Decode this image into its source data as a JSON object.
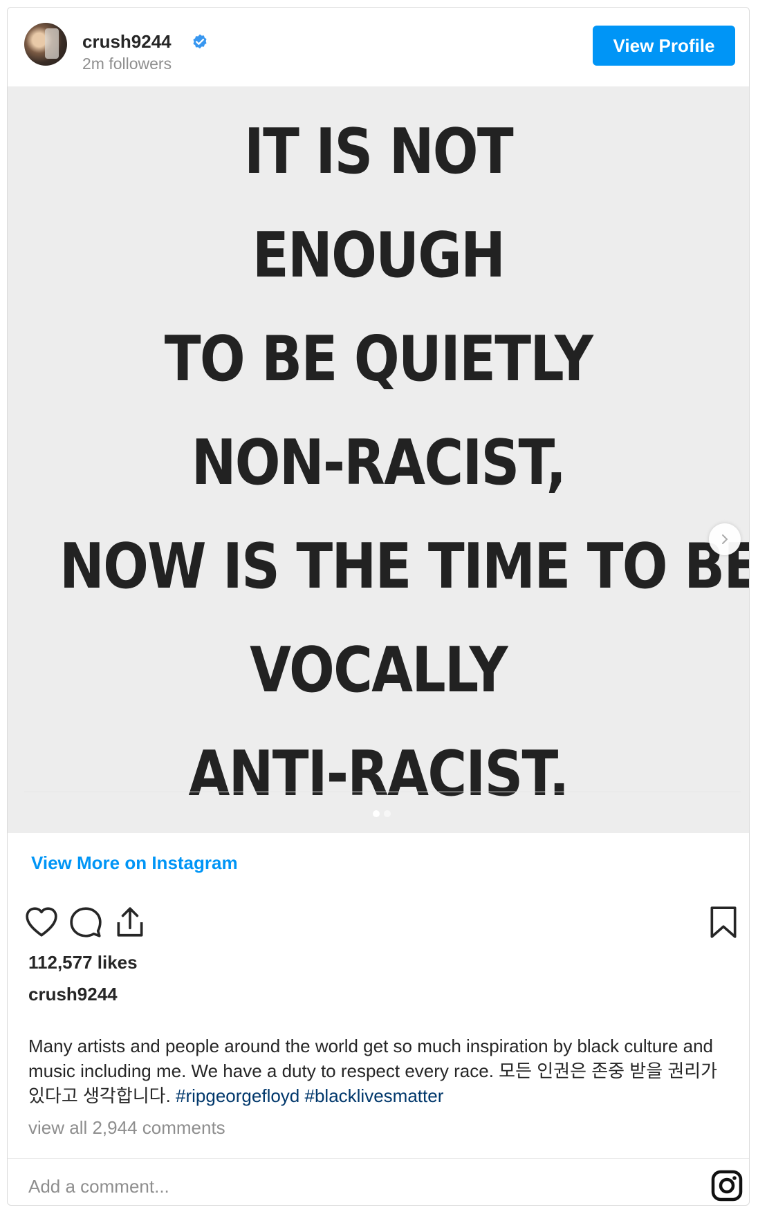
{
  "header": {
    "username": "crush9244",
    "followers": "2m followers",
    "view_profile_label": "View Profile"
  },
  "post_image": {
    "lines": [
      "IT IS NOT",
      "ENOUGH",
      "TO BE QUIETLY",
      "NON-RACIST,",
      "NOW IS THE TIME TO BE",
      "VOCALLY",
      "ANTI-RACIST."
    ],
    "carousel_current": 1,
    "carousel_total": 2
  },
  "view_more_label": "View More on Instagram",
  "actions": {
    "like_icon": "heart-icon",
    "comment_icon": "comment-icon",
    "share_icon": "share-icon",
    "save_icon": "bookmark-icon"
  },
  "likes": "112,577 likes",
  "caption": {
    "author": "crush9244",
    "text": "Many artists and people around the world get so much inspiration by black culture and music including me. We have a duty to respect every race. 모든 인권은 존중 받을 권리가 있다고 생각합니다. ",
    "hashtags": [
      "#ripgeorgefloyd",
      "#blacklivesmatter"
    ]
  },
  "comments_link": "view all 2,944 comments",
  "comment_input": {
    "placeholder": "Add a comment..."
  },
  "colors": {
    "accent": "#0095f6",
    "hashtag": "#00376b",
    "muted": "#8e8e8e",
    "image_bg": "#ededed"
  }
}
